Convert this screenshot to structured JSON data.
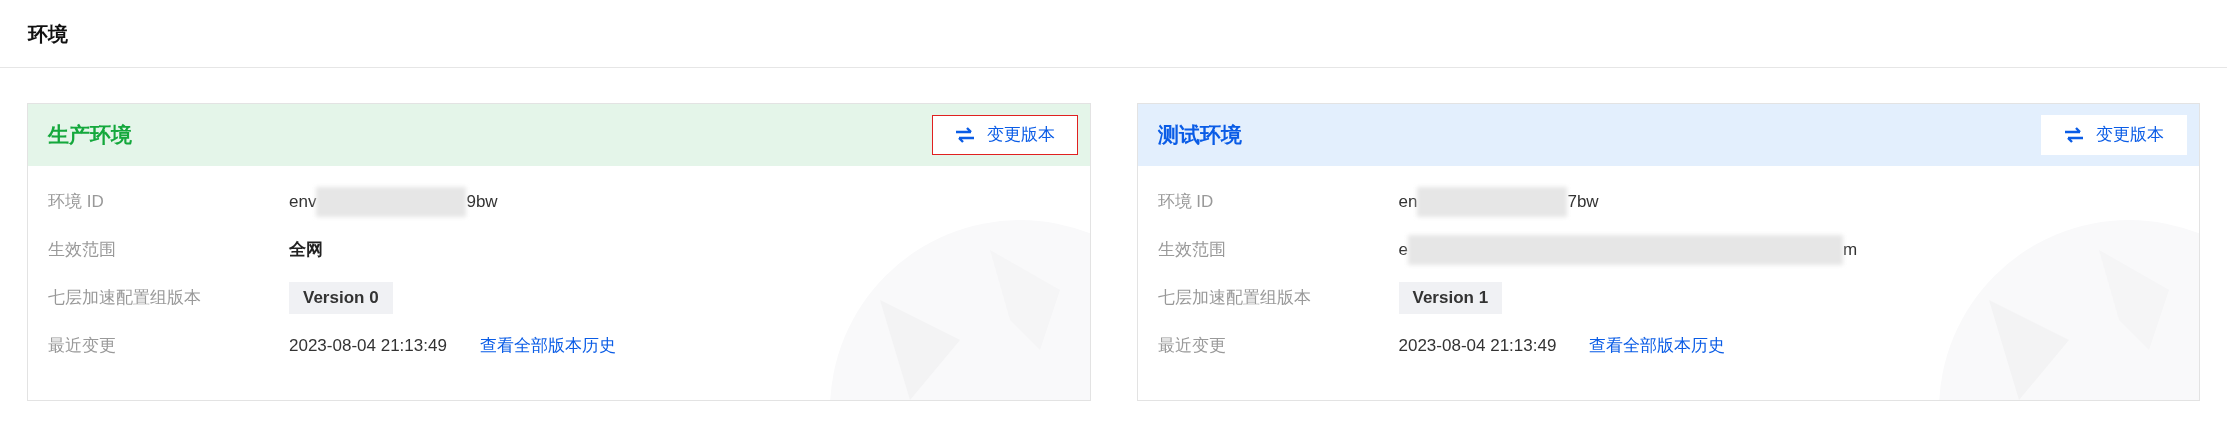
{
  "page_title": "环境",
  "environments": [
    {
      "kind": "production",
      "title": "生产环境",
      "action": {
        "label": "变更版本",
        "focused": true
      },
      "rows": [
        {
          "label": "环境 ID",
          "kind": "segments",
          "segments": [
            {
              "kind": "text",
              "text": "env"
            },
            {
              "kind": "redacted"
            },
            {
              "kind": "text",
              "text": "9bw"
            }
          ]
        },
        {
          "label": "生效范围",
          "kind": "bold",
          "value": "全网"
        },
        {
          "label": "七层加速配置组版本",
          "kind": "tag",
          "value": "Version 0"
        },
        {
          "label": "最近变更",
          "kind": "time",
          "value": "2023-08-04 21:13:49",
          "link": "查看全部版本历史"
        }
      ]
    },
    {
      "kind": "test",
      "title": "测试环境",
      "action": {
        "label": "变更版本",
        "focused": false
      },
      "rows": [
        {
          "label": "环境 ID",
          "kind": "segments",
          "segments": [
            {
              "kind": "text",
              "text": "en"
            },
            {
              "kind": "redacted"
            },
            {
              "kind": "text",
              "text": "7bw"
            }
          ]
        },
        {
          "label": "生效范围",
          "kind": "segments",
          "segments": [
            {
              "kind": "text",
              "text": "e"
            },
            {
              "kind": "redacted",
              "wide": true
            },
            {
              "kind": "text",
              "text": "m"
            }
          ]
        },
        {
          "label": "七层加速配置组版本",
          "kind": "tag",
          "value": "Version 1"
        },
        {
          "label": "最近变更",
          "kind": "time",
          "value": "2023-08-04 21:13:49",
          "link": "查看全部版本历史"
        }
      ]
    }
  ]
}
